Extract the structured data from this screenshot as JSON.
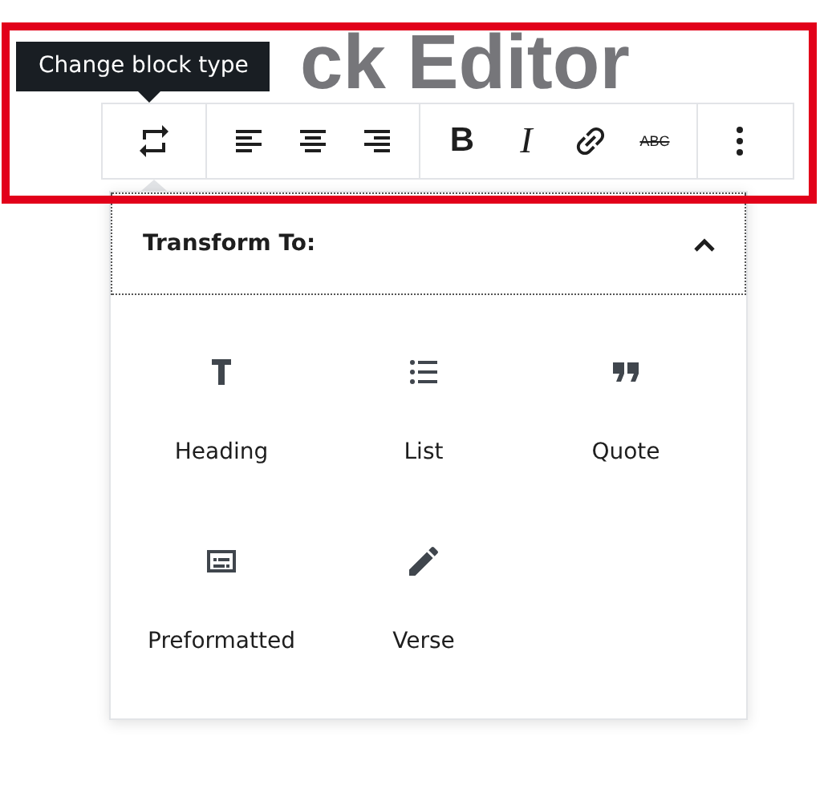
{
  "heading": {
    "text": "ck Editor"
  },
  "tooltip": {
    "text": "Change block type"
  },
  "toolbar": {
    "groups": [
      {
        "buttons": [
          {
            "kind": "transform"
          }
        ]
      },
      {
        "buttons": [
          {
            "kind": "align-left"
          },
          {
            "kind": "align-center"
          },
          {
            "kind": "align-right"
          }
        ]
      },
      {
        "buttons": [
          {
            "kind": "bold",
            "label": "B"
          },
          {
            "kind": "italic",
            "label": "I"
          },
          {
            "kind": "link"
          },
          {
            "kind": "strikethrough",
            "label": "ABC"
          }
        ]
      },
      {
        "buttons": [
          {
            "kind": "more"
          }
        ]
      }
    ]
  },
  "popover": {
    "title": "Transform To:",
    "expanded": true,
    "items": [
      {
        "kind": "heading",
        "label": "Heading"
      },
      {
        "kind": "list",
        "label": "List"
      },
      {
        "kind": "quote",
        "label": "Quote"
      },
      {
        "kind": "preformatted",
        "label": "Preformatted"
      },
      {
        "kind": "verse",
        "label": "Verse"
      }
    ]
  }
}
